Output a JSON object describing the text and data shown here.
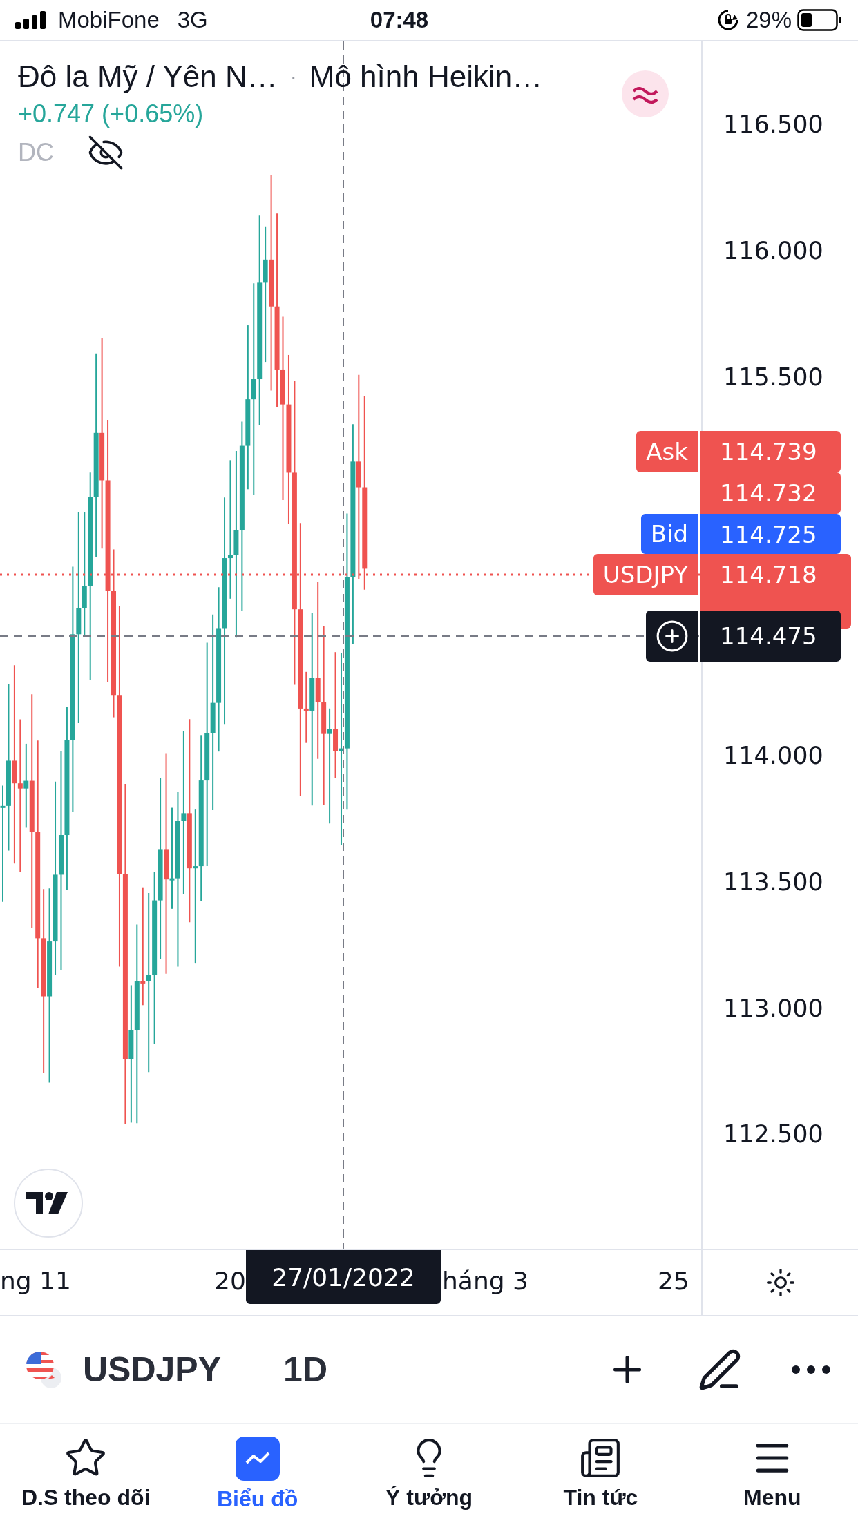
{
  "status_bar": {
    "carrier": "MobiFone",
    "network": "3G",
    "time": "07:48",
    "battery": "29%"
  },
  "legend": {
    "symbol": "Đô la Mỹ / Yên N…",
    "separator": "·",
    "chart_type": "Mô hình Heikin…",
    "change": "+0.747 (+0.65%)",
    "indicator": "DC",
    "indicator_hidden": true
  },
  "price_axis": {
    "upper": [
      "116.500",
      "116.000",
      "115.500"
    ],
    "lower": [
      "114.000",
      "113.500",
      "113.000",
      "112.500"
    ]
  },
  "price_tags": [
    {
      "kind": "ask",
      "label": "Ask",
      "value": "114.739"
    },
    {
      "kind": "plain",
      "value": "114.732"
    },
    {
      "kind": "bid",
      "label": "Bid",
      "value": "114.725"
    },
    {
      "kind": "last",
      "label": "USDJPY",
      "value": "114.718"
    },
    {
      "kind": "crosshair",
      "value": "114.475"
    }
  ],
  "time_axis": {
    "labels": [
      "ng 11",
      "20",
      "háng 3",
      "25"
    ],
    "crosshair_date": "27/01/2022"
  },
  "symbol_bar": {
    "symbol": "USDJPY",
    "interval": "1D"
  },
  "tabs": [
    {
      "kind": "watchlist",
      "label": "D.S theo dõi",
      "selected": false
    },
    {
      "kind": "chart",
      "label": "Biểu đồ",
      "selected": true
    },
    {
      "kind": "ideas",
      "label": "Ý tưởng",
      "selected": false
    },
    {
      "kind": "news",
      "label": "Tin tức",
      "selected": false
    },
    {
      "kind": "menu",
      "label": "Menu",
      "selected": false
    }
  ]
}
